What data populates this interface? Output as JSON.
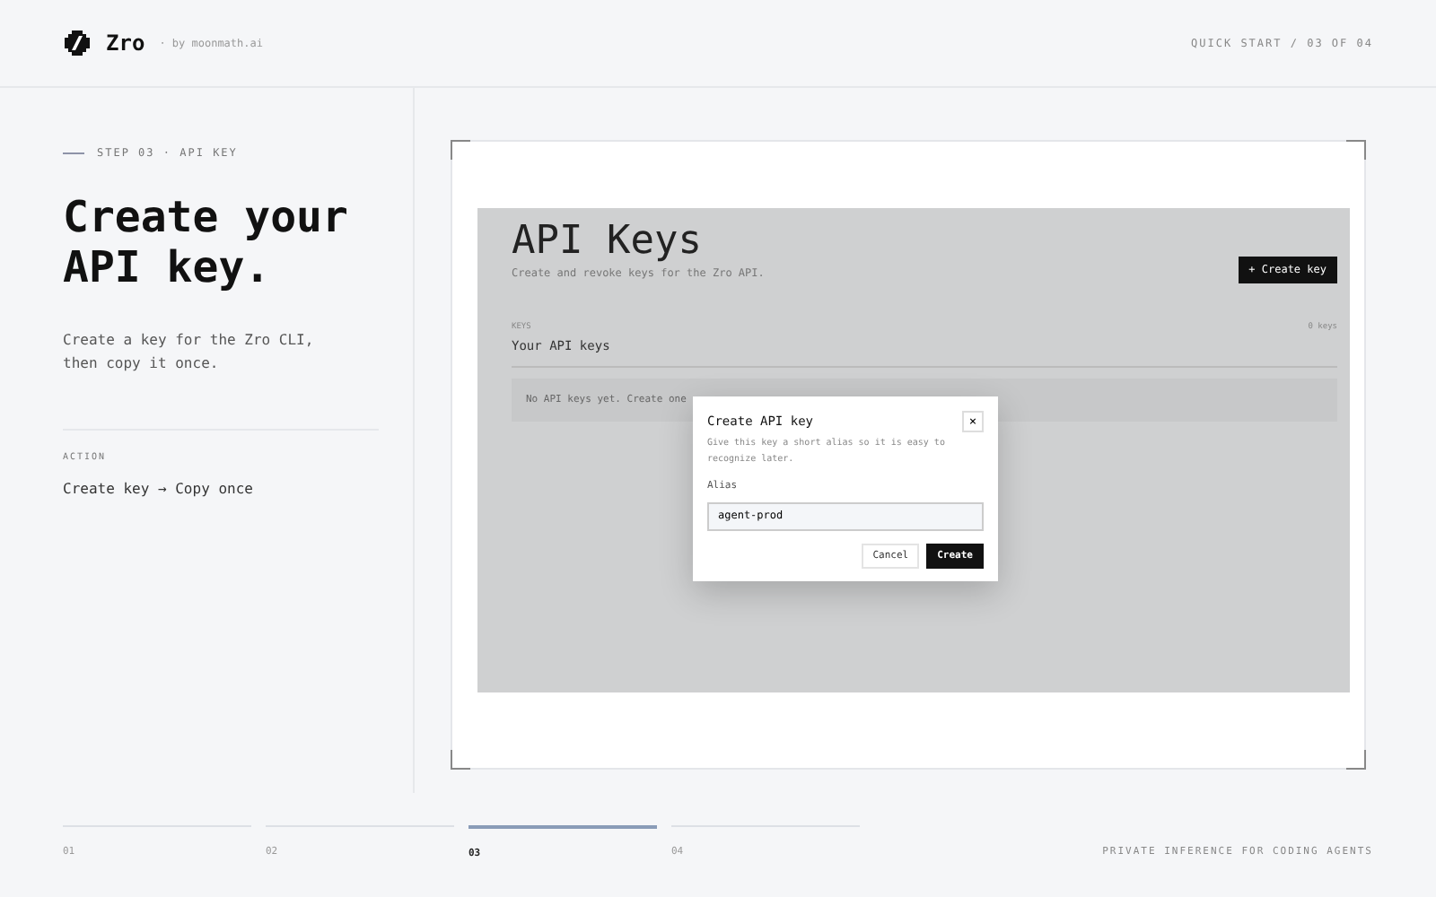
{
  "header": {
    "brand": "Zro",
    "byline": "· by moonmath.ai",
    "progress": "QUICK START / 03 OF 04"
  },
  "step": {
    "eyebrow": "STEP 03 · API KEY",
    "title": "Create your API key.",
    "description": "Create a key for the Zro CLI, then copy it once.",
    "action_label": "ACTION",
    "action": "Create key → Copy once"
  },
  "preview": {
    "title": "API Keys",
    "subtitle": "Create and revoke keys for the Zro API.",
    "create_button": "+ Create key",
    "section_label": "KEYS",
    "count": "0 keys",
    "section_title": "Your API keys",
    "empty_text": "No API keys yet. Create one",
    "dialog": {
      "title": "Create API key",
      "close": "×",
      "description": "Give this key a short alias so it is easy to recognize later.",
      "field_label": "Alias",
      "value": "agent-prod",
      "buttons": [
        {
          "label": "Cancel",
          "kind": "secondary"
        },
        {
          "label": "Create",
          "kind": "primary"
        }
      ]
    }
  },
  "footer": {
    "steps": [
      {
        "label": "01",
        "selected": false
      },
      {
        "label": "02",
        "selected": false
      },
      {
        "label": "03",
        "selected": true
      },
      {
        "label": "04",
        "selected": false
      }
    ],
    "tagline": "PRIVATE INFERENCE FOR CODING AGENTS"
  }
}
